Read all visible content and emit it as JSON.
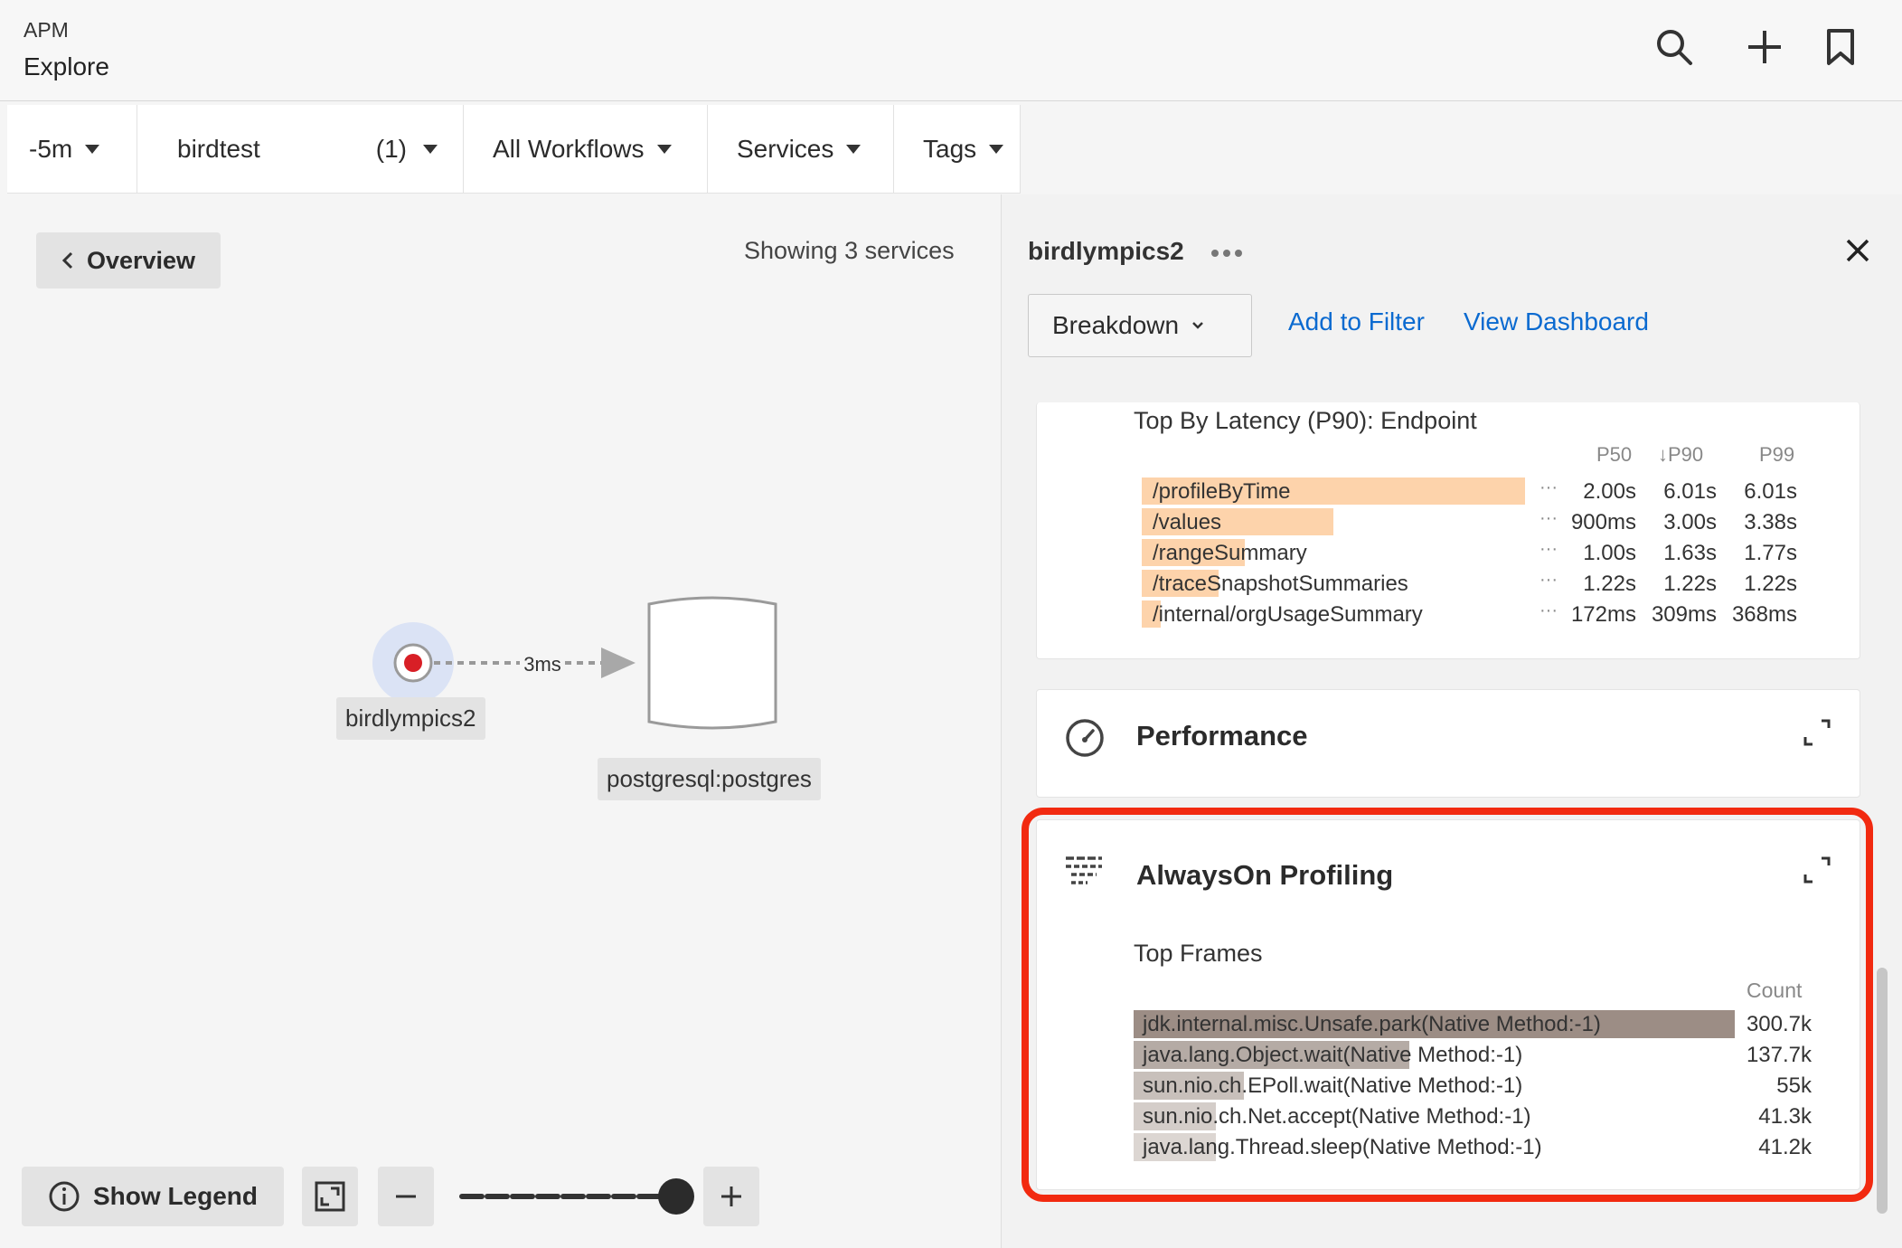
{
  "header": {
    "app_label": "APM",
    "title": "Explore",
    "icons": [
      "search-icon",
      "plus-icon",
      "bookmark-icon"
    ]
  },
  "filters": {
    "time": "-5m",
    "environment": "birdtest",
    "environment_count": "(1)",
    "workflows": "All Workflows",
    "services": "Services",
    "tags": "Tags"
  },
  "map": {
    "overview_label": "Overview",
    "showing_text": "Showing 3 services",
    "service_node": "birdlympics2",
    "db_node": "postgresql:postgres",
    "edge_label": "3ms",
    "show_legend_label": "Show Legend",
    "zoom_level": 1.0
  },
  "panel": {
    "title": "birdlympics2",
    "breakdown_label": "Breakdown",
    "add_filter_label": "Add to Filter",
    "view_dashboard_label": "View Dashboard",
    "latency": {
      "title": "Top By Latency (P90): Endpoint",
      "columns": [
        "P50",
        "↓P90",
        "P99"
      ],
      "rows": [
        {
          "name": "/profileByTime",
          "p50": "2.00s",
          "p90": "6.01s",
          "p99": "6.01s",
          "share": 1.0
        },
        {
          "name": "/values",
          "p50": "900ms",
          "p90": "3.00s",
          "p99": "3.38s",
          "share": 0.5
        },
        {
          "name": "/rangeSummary",
          "p50": "1.00s",
          "p90": "1.63s",
          "p99": "1.77s",
          "share": 0.27
        },
        {
          "name": "/traceSnapshotSummaries",
          "p50": "1.22s",
          "p90": "1.22s",
          "p99": "1.22s",
          "share": 0.2
        },
        {
          "name": "/internal/orgUsageSummary",
          "p50": "172ms",
          "p90": "309ms",
          "p99": "368ms",
          "share": 0.05
        }
      ]
    },
    "performance_title": "Performance",
    "profiling": {
      "title": "AlwaysOn Profiling",
      "frames_title": "Top Frames",
      "count_header": "Count",
      "frames": [
        {
          "name": "jdk.internal.misc.Unsafe.park(Native Method:-1)",
          "count": "300.7k",
          "share": 1.0,
          "color": "#9c8d85"
        },
        {
          "name": "java.lang.Object.wait(Native Method:-1)",
          "count": "137.7k",
          "share": 0.458,
          "color": "#b5aba5"
        },
        {
          "name": "sun.nio.ch.EPoll.wait(Native Method:-1)",
          "count": "55k",
          "share": 0.183,
          "color": "#c8c0bb"
        },
        {
          "name": "sun.nio.ch.Net.accept(Native Method:-1)",
          "count": "41.3k",
          "share": 0.137,
          "color": "#d4cdc9"
        },
        {
          "name": "java.lang.Thread.sleep(Native Method:-1)",
          "count": "41.2k",
          "share": 0.137,
          "color": "#dcd6d2"
        }
      ]
    }
  },
  "colors": {
    "accent_link": "#0b6ad0",
    "highlight": "#f22a10",
    "latency_bar": "#fdd3ab",
    "service_node": "#d81f26"
  }
}
